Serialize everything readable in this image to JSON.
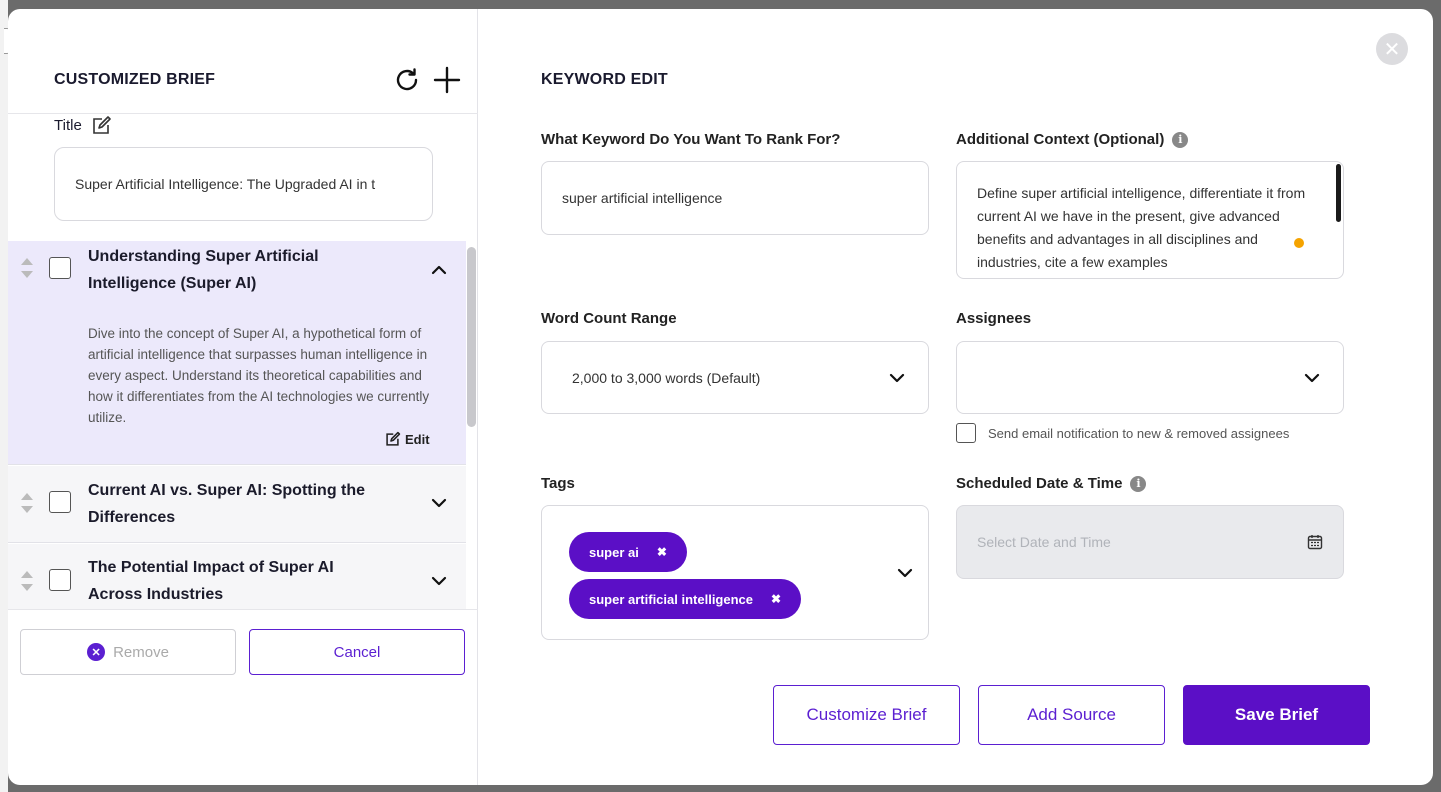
{
  "left": {
    "heading": "CUSTOMIZED BRIEF",
    "title_label": "Title",
    "title_value": "Super Artificial Intelligence: The Upgraded AI in t",
    "outline": [
      {
        "title": "Understanding Super Artificial Intelligence (Super AI)",
        "expanded": true,
        "description": "Dive into the concept of Super AI, a hypothetical form of artificial intelligence that surpasses human intelligence in every aspect. Understand its theoretical capabilities and how it differentiates from the AI technologies we currently utilize.",
        "edit_label": "Edit"
      },
      {
        "title": "Current AI vs. Super AI: Spotting the Differences",
        "expanded": false
      },
      {
        "title": "The Potential Impact of Super AI Across Industries",
        "expanded": false
      }
    ],
    "remove_label": "Remove",
    "cancel_label": "Cancel"
  },
  "right": {
    "heading": "KEYWORD EDIT",
    "keyword_label": "What Keyword Do You Want To Rank For?",
    "keyword_value": "super artificial intelligence",
    "context_label": "Additional Context (Optional)",
    "context_value": "Define super artificial intelligence, differentiate it from current AI we have in the present, give advanced benefits and advantages in all disciplines and industries, cite a few examples",
    "wordcount_label": "Word Count Range",
    "wordcount_value": "2,000 to 3,000 words (Default)",
    "assignees_label": "Assignees",
    "notify_label": "Send email notification to new & removed assignees",
    "tags_label": "Tags",
    "tags": [
      "super ai",
      "super artificial intelligence"
    ],
    "date_label": "Scheduled Date & Time",
    "date_placeholder": "Select Date and Time",
    "buttons": {
      "customize": "Customize Brief",
      "add_source": "Add Source",
      "save": "Save Brief"
    }
  },
  "colors": {
    "accent": "#5b0fc6",
    "highlight": "#ece9fb",
    "indicator": "#f5a300"
  },
  "icons": [
    "refresh-icon",
    "plus-icon",
    "edit-icon",
    "drag-handle-icon",
    "chevron-up-icon",
    "chevron-down-icon",
    "close-icon",
    "info-icon",
    "calendar-icon",
    "tag-remove-icon"
  ]
}
